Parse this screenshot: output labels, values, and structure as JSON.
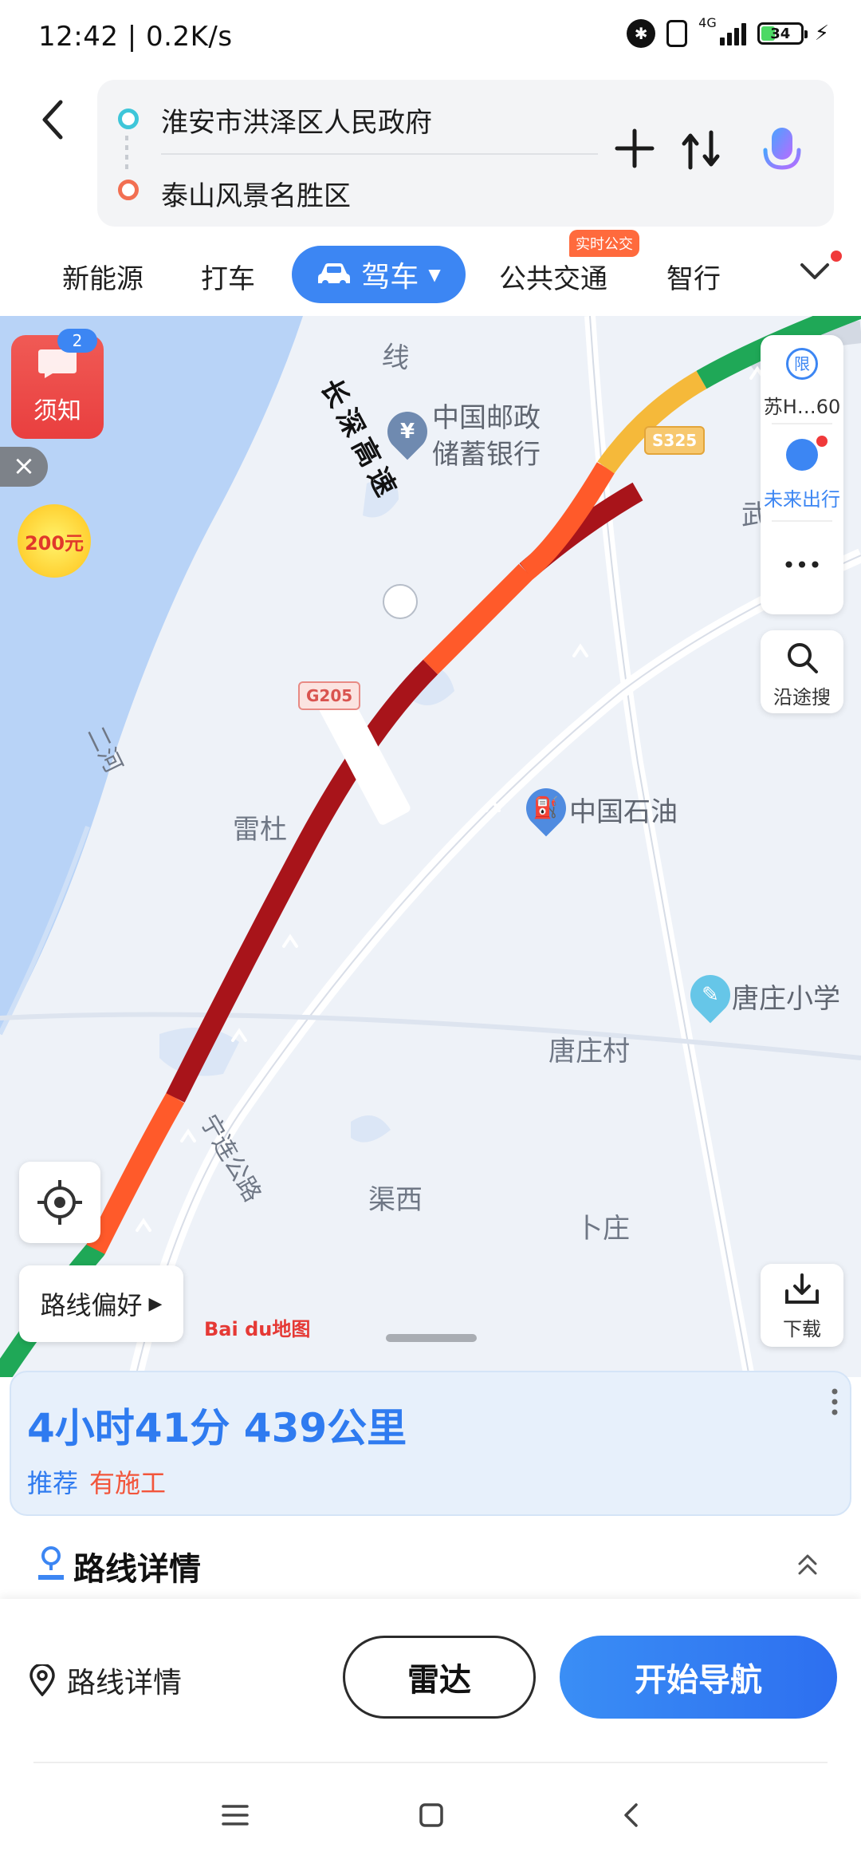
{
  "status": {
    "time": "12:42 | 0.2K/s",
    "network": "4G",
    "battery": "34"
  },
  "route": {
    "from": "淮安市洪泽区人民政府",
    "to": "泰山风景名胜区"
  },
  "tabs": {
    "items": [
      "新能源",
      "打车",
      "驾车",
      "公共交通",
      "智行"
    ],
    "live_badge": "实时公交"
  },
  "map": {
    "labels": {
      "bank_line1": "中国邮政",
      "bank_line2": "储蓄银行",
      "gas": "中国石油",
      "leidu": "雷杜",
      "school": "唐庄小学",
      "village": "唐庄村",
      "quxi": "渠西",
      "buzhuang": "卜庄",
      "highway": "长深高速",
      "river": "二河",
      "line_top": "线",
      "wu_top": "武",
      "ning_road": "宁连公路"
    },
    "shields": {
      "s325": "S325",
      "g205": "G205"
    },
    "icons": {
      "bank": "¥",
      "yuan_text": "200元"
    },
    "notice": {
      "label": "须知",
      "count": "2"
    },
    "side": {
      "plate_badge": "限",
      "plate": "苏H…60",
      "future": "未来出行",
      "more": "•••",
      "search": "沿途搜",
      "download": "下载"
    },
    "route_pref": "路线偏好",
    "baidu": "Bai du地图",
    "route_colors": {
      "smooth": "#1fa857",
      "slow": "#f5b93a",
      "congested": "#ff5a2a",
      "jammed": "#a8141a"
    }
  },
  "summary": {
    "time_distance": "4小时41分  439公里",
    "tag_recommend": "推荐",
    "tag_construction": "有施工"
  },
  "details": {
    "title": "路线详情"
  },
  "bottom": {
    "detail_link": "路线详情",
    "radar": "雷达",
    "navigate": "开始导航"
  }
}
